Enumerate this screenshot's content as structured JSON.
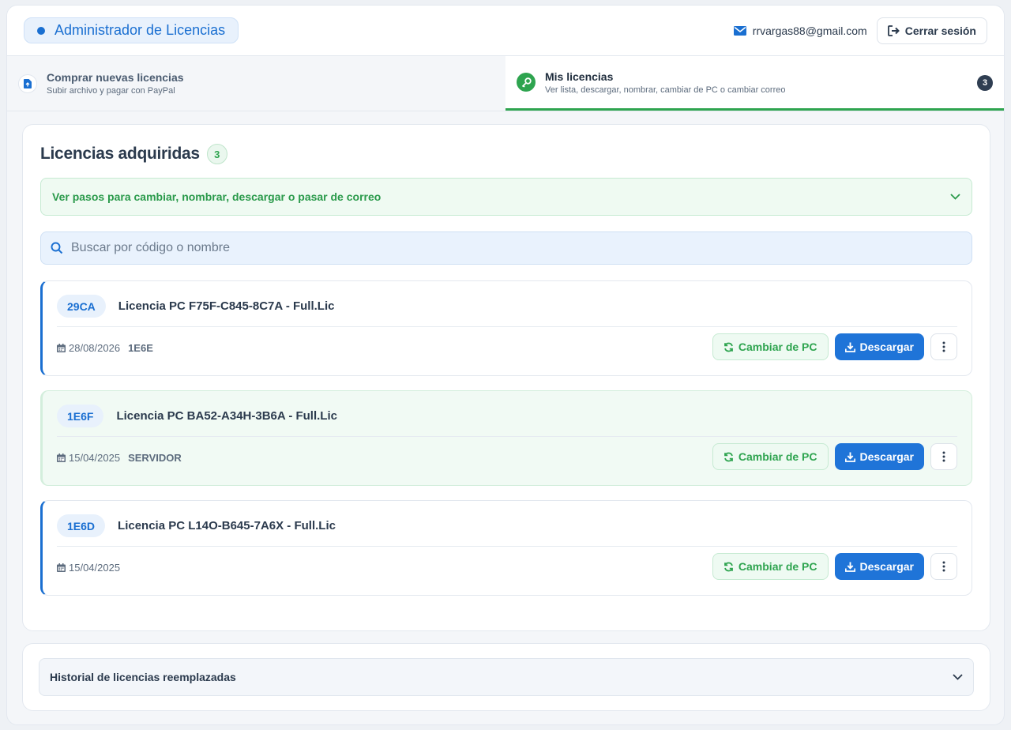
{
  "header": {
    "app_title": "Administrador de Licencias",
    "user_email": "rrvargas88@gmail.com",
    "logout_label": "Cerrar sesión"
  },
  "tabs": [
    {
      "title": "Comprar nuevas licencias",
      "subtitle": "Subir archivo y pagar con PayPal",
      "icon": "upload-file-icon",
      "active": false
    },
    {
      "title": "Mis licencias",
      "subtitle": "Ver lista, descargar, nombrar, cambiar de PC o cambiar correo",
      "icon": "key-icon",
      "active": true,
      "count": "3"
    }
  ],
  "main": {
    "title": "Licencias adquiridas",
    "count": "3",
    "steps_label": "Ver pasos para cambiar, nombrar, descargar o pasar de correo",
    "search_placeholder": "Buscar por código o nombre",
    "licenses": [
      {
        "code": "29CA",
        "name": "Licencia PC F75F-C845-8C7A - Full.Lic",
        "date": "28/08/2026",
        "tag": "1E6E",
        "highlighted": false
      },
      {
        "code": "1E6F",
        "name": "Licencia PC BA52-A34H-3B6A - Full.Lic",
        "date": "15/04/2025",
        "tag": "SERVIDOR",
        "highlighted": true
      },
      {
        "code": "1E6D",
        "name": "Licencia PC L14O-B645-7A6X - Full.Lic",
        "date": "15/04/2025",
        "tag": "",
        "highlighted": false
      }
    ],
    "change_pc_label": "Cambiar de PC",
    "download_label": "Descargar"
  },
  "history": {
    "label": "Historial de licencias reemplazadas"
  },
  "colors": {
    "primary": "#1f74d8",
    "success": "#2ea44f",
    "dark": "#2f3e52"
  }
}
